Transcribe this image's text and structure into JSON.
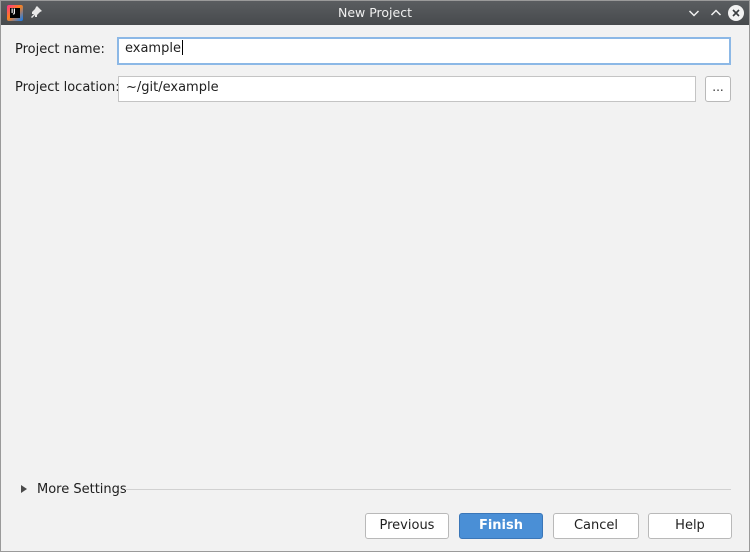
{
  "window": {
    "title": "New Project"
  },
  "form": {
    "project_name_label": "Project name:",
    "project_name_value": "example",
    "project_location_label": "Project location:",
    "project_location_value": "~/git/example",
    "browse_label": "..."
  },
  "more_settings": {
    "label": "More Settings",
    "expanded": false
  },
  "buttons": {
    "previous": "Previous",
    "finish": "Finish",
    "cancel": "Cancel",
    "help": "Help"
  },
  "colors": {
    "titlebar": "#4f5255",
    "primary_button": "#4a8fd6",
    "focus_border": "#8cb8e6",
    "background": "#f2f2f2"
  },
  "icons": {
    "app": "intellij-idea-icon",
    "pin": "pin-icon",
    "minimize": "chevron-down-icon",
    "maximize": "chevron-up-icon",
    "close": "close-icon",
    "expand": "triangle-right-icon"
  }
}
